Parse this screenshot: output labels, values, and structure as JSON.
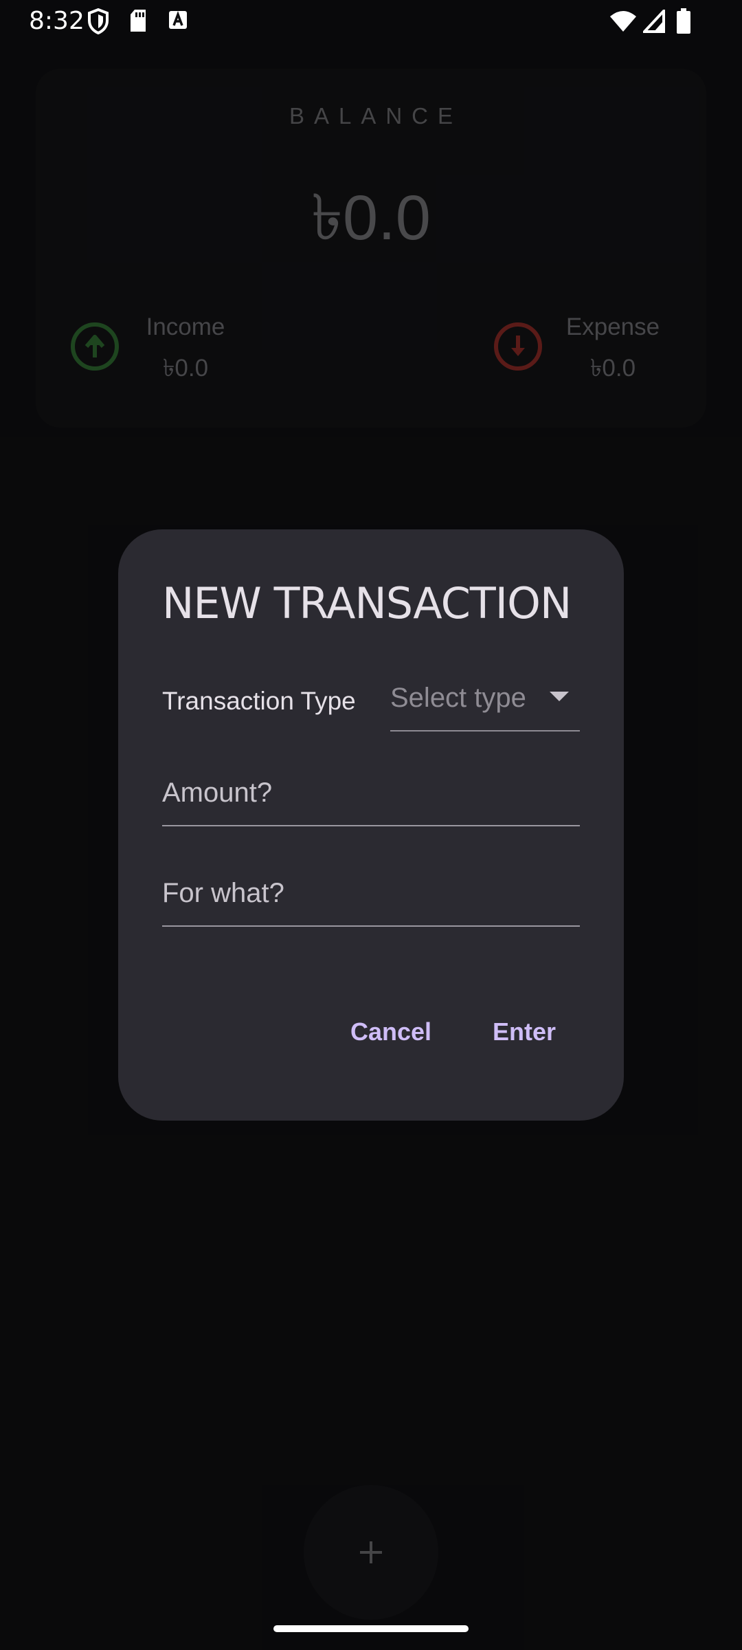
{
  "status_bar": {
    "time": "8:32",
    "icons_left": [
      "shield-icon",
      "sd-card-icon",
      "a-box-icon"
    ],
    "icons_right": [
      "wifi-icon",
      "cell-signal-icon",
      "battery-icon"
    ]
  },
  "balance_card": {
    "label": "BALANCE",
    "value": "৳0.0",
    "income": {
      "label": "Income",
      "value": "৳0.0",
      "icon": "arrow-up-circle-icon",
      "color": "#2e6b31"
    },
    "expense": {
      "label": "Expense",
      "value": "৳0.0",
      "icon": "arrow-down-circle-icon",
      "color": "#8a2a25"
    }
  },
  "dialog": {
    "title": "NEW TRANSACTION",
    "type_label": "Transaction Type",
    "type_select": {
      "placeholder": "Select type",
      "icon": "dropdown-arrow-icon"
    },
    "amount_placeholder": "Amount?",
    "for_what_placeholder": "For what?",
    "cancel_label": "Cancel",
    "enter_label": "Enter",
    "accent_color": "#cfbdf7"
  },
  "fab": {
    "icon": "plus-icon"
  }
}
